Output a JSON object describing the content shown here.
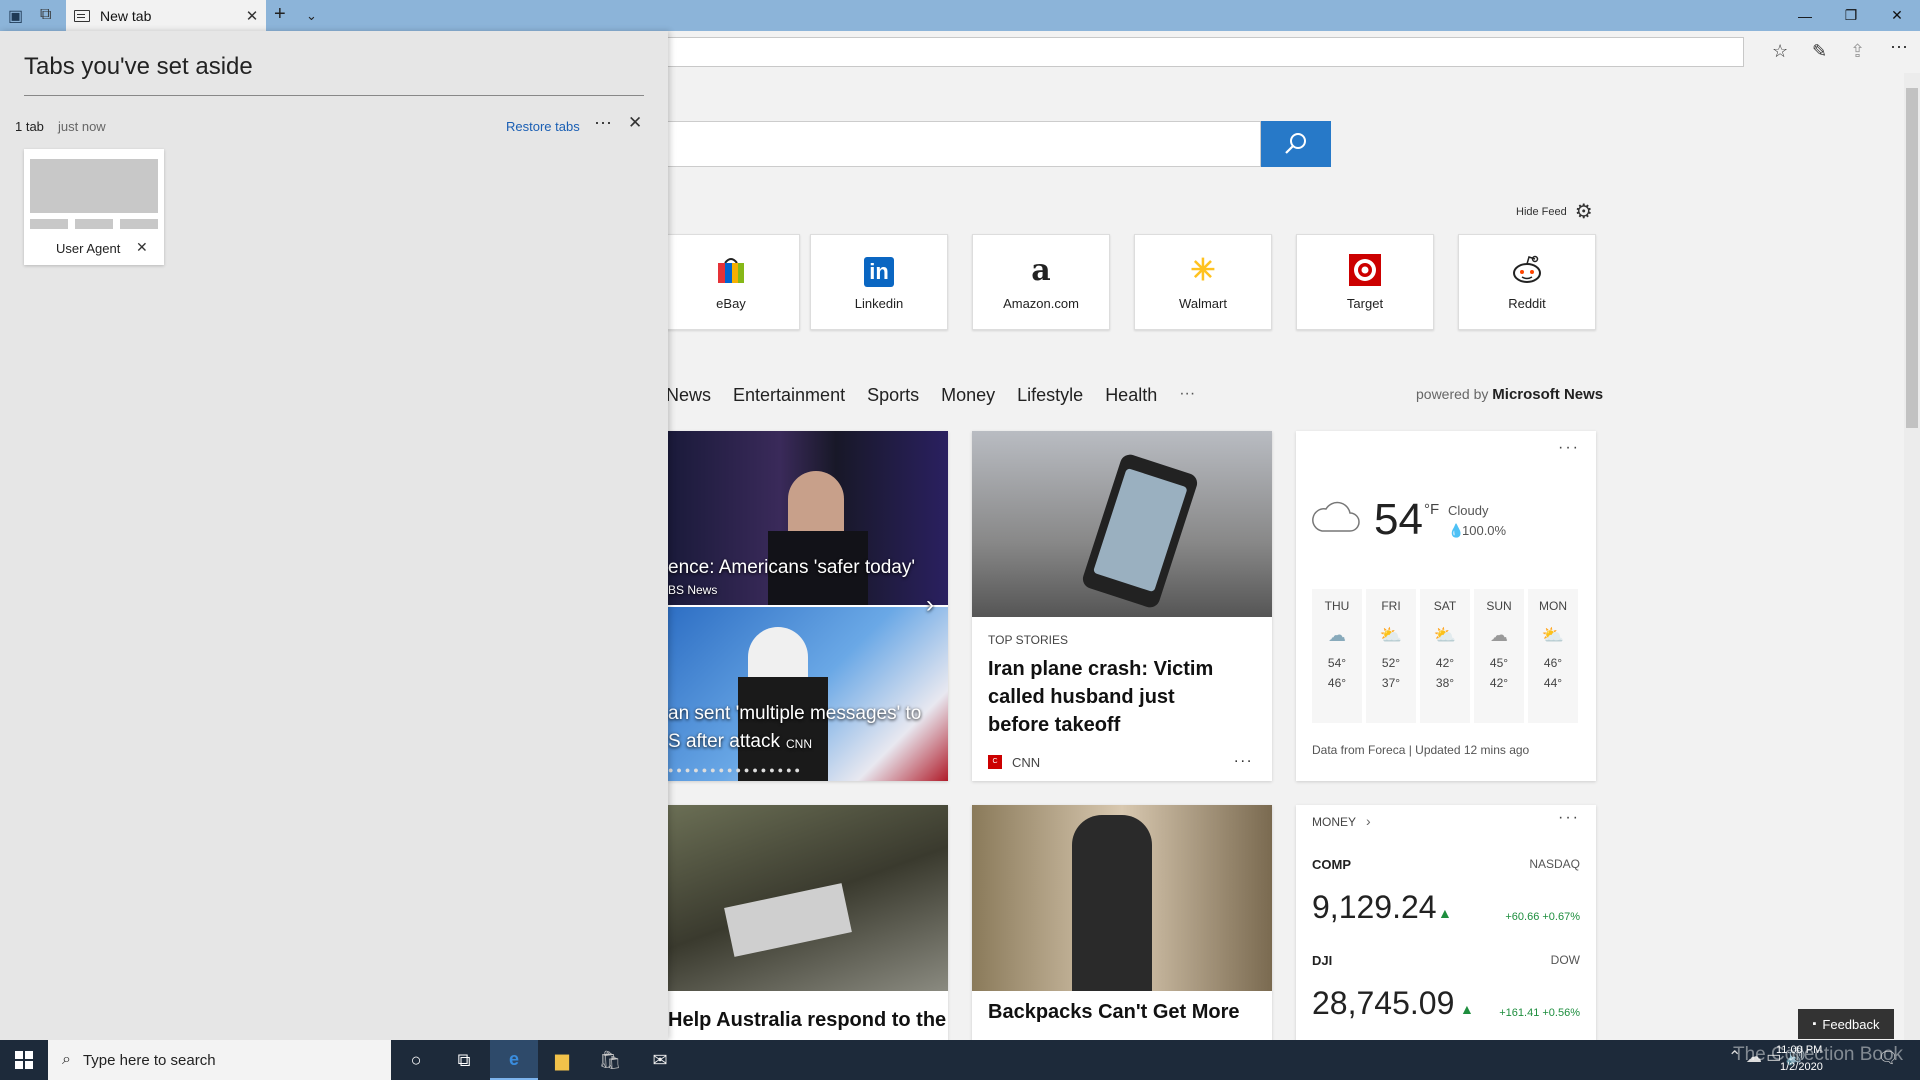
{
  "browser": {
    "tab_title": "New tab",
    "new_tab_icon": "plus-icon",
    "window_controls": [
      "minimize-icon",
      "restore-icon",
      "close-icon"
    ]
  },
  "aside_pane": {
    "title": "Tabs you've set aside",
    "group_count": "1 tab",
    "group_time": "just now",
    "restore_label": "Restore tabs",
    "more_label": "⋯",
    "tab_label": "User Agent"
  },
  "search": {
    "button_icon": "search-icon"
  },
  "feed": {
    "hide_label": "Hide Feed"
  },
  "sites": [
    {
      "label": "eBay",
      "icon": "ebay-icon"
    },
    {
      "label": "Linkedin",
      "icon": "linkedin-icon"
    },
    {
      "label": "Amazon.com",
      "icon": "amazon-icon"
    },
    {
      "label": "Walmart",
      "icon": "walmart-icon"
    },
    {
      "label": "Target",
      "icon": "target-icon"
    },
    {
      "label": "Reddit",
      "icon": "reddit-icon"
    }
  ],
  "categories": [
    "News",
    "Entertainment",
    "Sports",
    "Money",
    "Lifestyle",
    "Health",
    "···"
  ],
  "powered": {
    "prefix": "powered by",
    "brand": "Microsoft News"
  },
  "carousel": {
    "caption1": "ence: Americans 'safer today'",
    "source1": "BS News",
    "caption2a": "an sent 'multiple messages' to",
    "caption2b": "S after attack",
    "source2": "CNN"
  },
  "top_story": {
    "kicker": "TOP STORIES",
    "headline": "Iran plane crash: Victim called husband just before takeoff",
    "source": "CNN",
    "more": "..."
  },
  "weather": {
    "temp": "54",
    "unit": "°F",
    "condition": "Cloudy",
    "precip": "100.0%",
    "days": [
      {
        "d": "THU",
        "hi": "54°",
        "lo": "46°"
      },
      {
        "d": "FRI",
        "hi": "52°",
        "lo": "37°"
      },
      {
        "d": "SAT",
        "hi": "42°",
        "lo": "38°"
      },
      {
        "d": "SUN",
        "hi": "45°",
        "lo": "42°"
      },
      {
        "d": "MON",
        "hi": "46°",
        "lo": "44°"
      }
    ],
    "footer": "Data from Foreca | Updated 12 mins ago"
  },
  "money": {
    "title": "MONEY",
    "rows": [
      {
        "sym": "COMP",
        "exch": "NASDAQ",
        "val": "9,129.24",
        "chg": "+60.66 +0.67%"
      },
      {
        "sym": "DJI",
        "exch": "DOW",
        "val": "28,745.09",
        "chg": "+161.41 +0.56%"
      }
    ]
  },
  "bottom_left_headline": "Help Australia respond to the",
  "bottom_mid_headline": "Backpacks Can't Get More",
  "feedback_label": "Feedback",
  "taskbar": {
    "search_placeholder": "Type here to search",
    "time": "11:00 PM",
    "date": "1/2/2020",
    "watermark": "The Collection Book"
  }
}
